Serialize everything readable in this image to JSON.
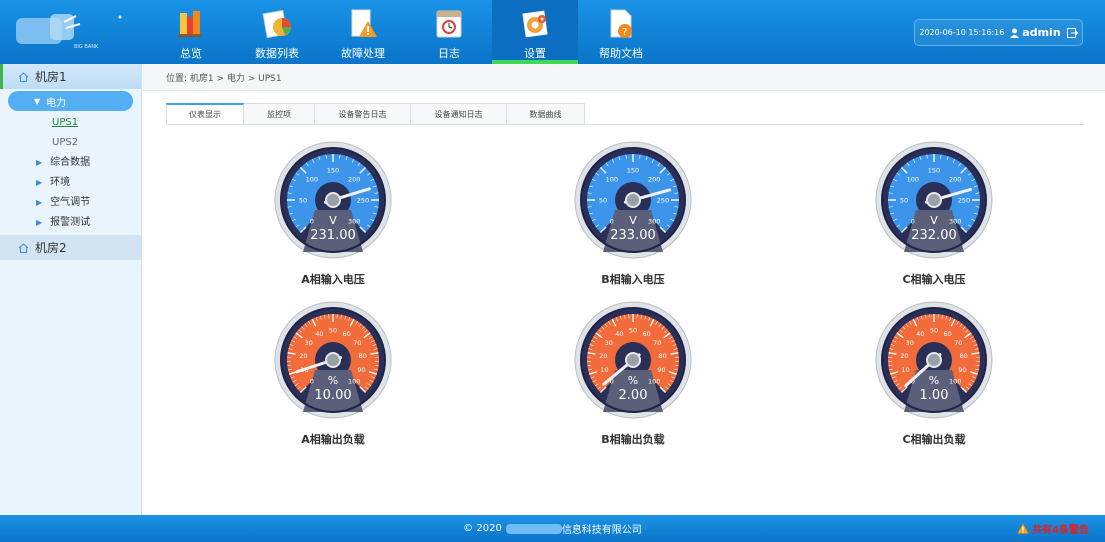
{
  "header": {
    "logo_text": "BIG BANK",
    "nav": [
      {
        "label": "总览",
        "icon": "overview-books-icon"
      },
      {
        "label": "数据列表",
        "icon": "data-list-icon"
      },
      {
        "label": "故障处理",
        "icon": "fault-warning-icon"
      },
      {
        "label": "日志",
        "icon": "calendar-log-icon"
      },
      {
        "label": "设置",
        "icon": "settings-gear-icon"
      },
      {
        "label": "帮助文档",
        "icon": "help-doc-icon"
      }
    ],
    "active_nav": "设置",
    "datetime": "2020-06-10  15:16:16",
    "username": "admin"
  },
  "sidebar": {
    "room1": "机房1",
    "power": "电力",
    "ups1": "UPS1",
    "ups2": "UPS2",
    "items": [
      "综合数据",
      "环境",
      "空气调节",
      "报警测试"
    ],
    "room2": "机房2"
  },
  "breadcrumb": "位置:  机房1 > 电力 > UPS1",
  "tabs": [
    "仪表显示",
    "监控项",
    "设备警告日志",
    "设备通知日志",
    "数据曲线"
  ],
  "gauges": {
    "voltage": {
      "unit": "V",
      "min": 0,
      "max": 300,
      "ticks": [
        "0",
        "50",
        "100",
        "150",
        "200",
        "250",
        "300"
      ],
      "items": [
        {
          "title": "A相输入电压",
          "value": 231.0,
          "display": "231.00"
        },
        {
          "title": "B相输入电压",
          "value": 233.0,
          "display": "233.00"
        },
        {
          "title": "C相输入电压",
          "value": 232.0,
          "display": "232.00"
        }
      ]
    },
    "load": {
      "unit": "%",
      "min": 0,
      "max": 100,
      "ticks": [
        "0",
        "10",
        "20",
        "30",
        "40",
        "50",
        "60",
        "70",
        "80",
        "90",
        "100"
      ],
      "items": [
        {
          "title": "A相输出负载",
          "value": 10.0,
          "display": "10.00"
        },
        {
          "title": "B相输出负载",
          "value": 2.0,
          "display": "2.00"
        },
        {
          "title": "C相输出负载",
          "value": 1.0,
          "display": "1.00"
        }
      ]
    }
  },
  "footer": {
    "copyright_prefix": "© 2020",
    "company_suffix": "信息科技有限公司",
    "alarm": "共有4条警告"
  },
  "colors": {
    "header_blue": "#0a74c9",
    "active_green": "#3ed95a",
    "voltage_face": "#3c95ea",
    "load_face": "#f26b3a",
    "alarm_red": "#d22222"
  }
}
